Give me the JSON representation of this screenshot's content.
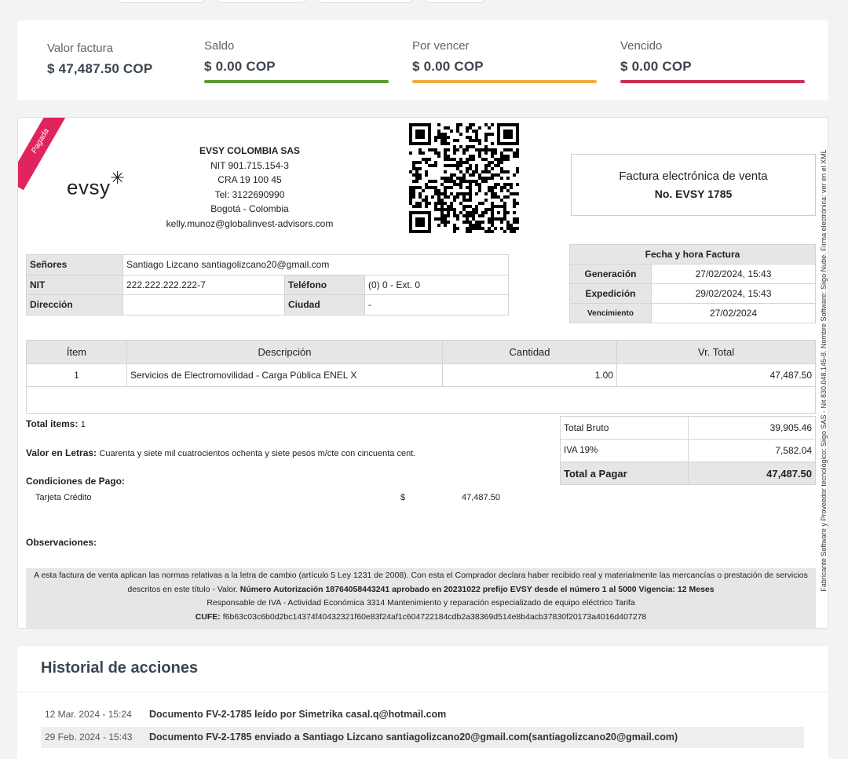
{
  "summary": {
    "valor_label": "Valor factura",
    "valor_value": "$ 47,487.50 COP",
    "saldo_label": "Saldo",
    "saldo_value": "$ 0.00 COP",
    "por_vencer_label": "Por vencer",
    "por_vencer_value": "$ 0.00 COP",
    "vencido_label": "Vencido",
    "vencido_value": "$ 0.00 COP",
    "colors": {
      "saldo": "#5b9a2e",
      "por_vencer": "#f2ac3f",
      "vencido": "#cc2b4f"
    }
  },
  "invoice": {
    "ribbon": "Pagada",
    "logo": "evsy",
    "company": {
      "name": "EVSY COLOMBIA SAS",
      "nit": "NIT 901.715.154-3",
      "address": "CRA 19 100 45",
      "tel": "Tel: 3122690990",
      "city": "Bogotá - Colombia",
      "email": "kelly.munoz@globalinvest-advisors.com"
    },
    "doc_title": "Factura electrónica de venta",
    "doc_number": "No. EVSY 1785",
    "vertical_note": "Fabricante Software y Proveedor tecnológico: Siigo SAS - Nit 830.048.145-8. Nombre Software: Siigo Nube. Firma electrónica: ver en el XML",
    "client": {
      "senores_label": "Señores",
      "senores_value": "Santiago Lizcano santiagolizcano20@gmail.com",
      "nit_label": "NIT",
      "nit_value": "222.222.222.222-7",
      "telefono_label": "Teléfono",
      "telefono_value": "(0) 0 - Ext. 0",
      "direccion_label": "Dirección",
      "direccion_value": "",
      "ciudad_label": "Ciudad",
      "ciudad_value": "-"
    },
    "dates": {
      "header": "Fecha y hora Factura",
      "generacion_label": "Generación",
      "generacion_value": "27/02/2024, 15:43",
      "expedicion_label": "Expedición",
      "expedicion_value": "29/02/2024, 15:43",
      "vencimiento_label": "Vencimiento",
      "vencimiento_value": "27/02/2024"
    },
    "items": {
      "headers": [
        "Ítem",
        "Descripción",
        "Cantidad",
        "Vr. Total"
      ],
      "rows": [
        [
          "1",
          "Servicios de Electromovilidad - Carga Pública ENEL X",
          "1.00",
          "47,487.50"
        ]
      ]
    },
    "total_items_label": "Total items:",
    "total_items_value": "1",
    "valor_letras_label": "Valor en Letras:",
    "valor_letras_value": "Cuarenta y siete mil cuatrocientos ochenta y siete pesos m/cte con cincuenta cent.",
    "condiciones_label": "Condiciones de Pago:",
    "pago_method": "Tarjeta Crédito",
    "pago_currency": "$",
    "pago_amount": "47,487.50",
    "observaciones_label": "Observaciones:",
    "totals": {
      "bruto_label": "Total Bruto",
      "bruto_value": "39,905.46",
      "iva_label": "IVA 19%",
      "iva_value": "7,582.04",
      "pagar_label": "Total a Pagar",
      "pagar_value": "47,487.50"
    },
    "legal": {
      "line1": "A esta factura de venta aplican las normas relativas a la letra de cambio (artículo 5 Ley 1231 de 2008). Con esta el Comprador declara haber recibido real y materialmente las mercancías o prestación de servicios descritos en este título - Valor.",
      "line1_bold": "Número Autorización 18764058443241 aprobado en 20231022 prefijo EVSY desde el número 1 al 5000 Vigencia: 12 Meses",
      "line2": "Responsable de IVA - Actividad Económica 3314 Mantenimiento y reparación especializado de equipo eléctrico Tarifa",
      "cufe_label": "CUFE:",
      "cufe_value": "f6b63c03c6b0d2bc14374f40432321f60e83f24af1c604722184cdb2a38369d514e8b4acb37830f20173a4016d407278"
    }
  },
  "history": {
    "title": "Historial de acciones",
    "rows": [
      {
        "date": "12 Mar. 2024 - 15:24",
        "text": "Documento FV-2-1785 leído por Simetrika casal.q@hotmail.com"
      },
      {
        "date": "29 Feb. 2024 - 15:43",
        "text": "Documento FV-2-1785 enviado a Santiago Lizcano santiagolizcano20@gmail.com(santiagolizcano20@gmail.com)"
      }
    ]
  }
}
